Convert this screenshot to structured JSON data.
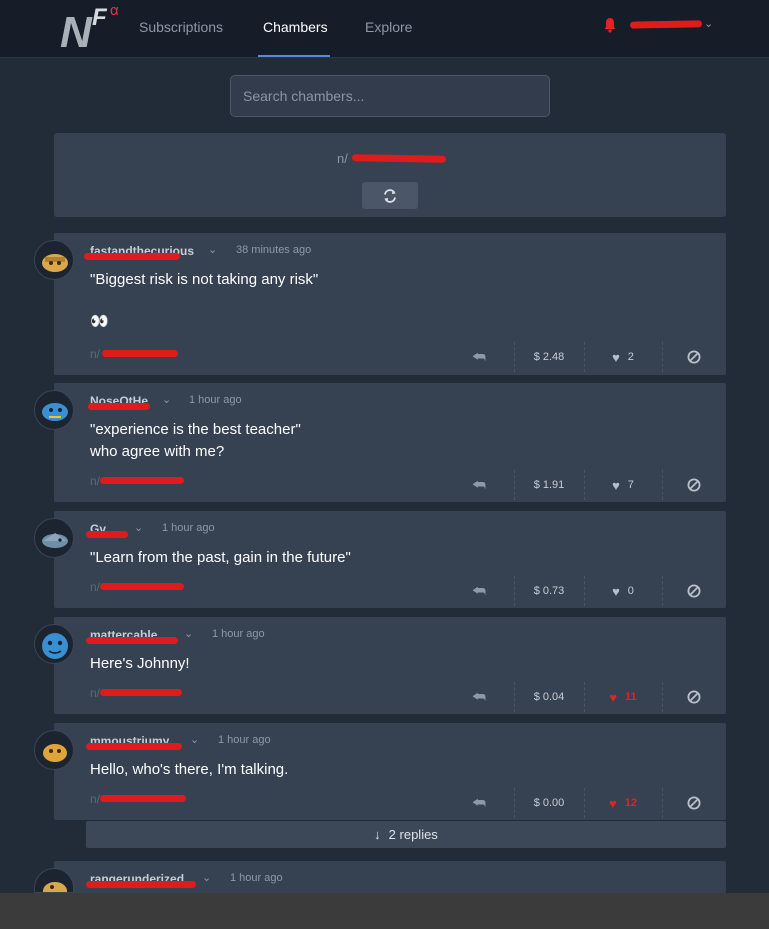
{
  "nav": {
    "logo_letters": "NF",
    "logo_alpha": "α",
    "tabs": [
      "Subscriptions",
      "Chambers",
      "Explore"
    ],
    "active_tab": "Chambers",
    "user_chevron": "⌄"
  },
  "search": {
    "placeholder": "Search chambers..."
  },
  "chamber": {
    "prefix": "n/"
  },
  "colors": {
    "accent": "#4c8fd8",
    "liked": "#e02424",
    "redaction": "#e01b1b"
  },
  "posts": [
    {
      "time": "38 minutes ago",
      "text_lines": [
        "\"Biggest risk is not taking any risk\""
      ],
      "emoji": "👀",
      "tag_prefix": "n/",
      "value": "$ 2.48",
      "likes": "2",
      "liked": false
    },
    {
      "time": "1 hour ago",
      "text_lines": [
        "\"experience is the best teacher\"",
        "who agree with me?"
      ],
      "tag_prefix": "n/",
      "value": "$ 1.91",
      "likes": "7",
      "liked": false
    },
    {
      "time": "1 hour ago",
      "text_lines": [
        "\"Learn from the past, gain in the future\""
      ],
      "tag_prefix": "n/",
      "value": "$ 0.73",
      "likes": "0",
      "liked": false
    },
    {
      "time": "1 hour ago",
      "text_lines": [
        "Here's Johnny!"
      ],
      "tag_prefix": "n/",
      "value": "$ 0.04",
      "likes": "11",
      "liked": true
    },
    {
      "time": "1 hour ago",
      "text_lines": [
        "Hello, who's there, I'm talking."
      ],
      "tag_prefix": "n/",
      "value": "$ 0.00",
      "likes": "12",
      "liked": true
    },
    {
      "time": "1 hour ago"
    }
  ],
  "replies": {
    "arrow": "↓",
    "label": "2 replies"
  },
  "icons": {
    "reply": "reply-arrow-icon",
    "heart": "heart-icon",
    "block": "block-icon",
    "refresh": "refresh-icon",
    "bell": "bell-icon"
  }
}
